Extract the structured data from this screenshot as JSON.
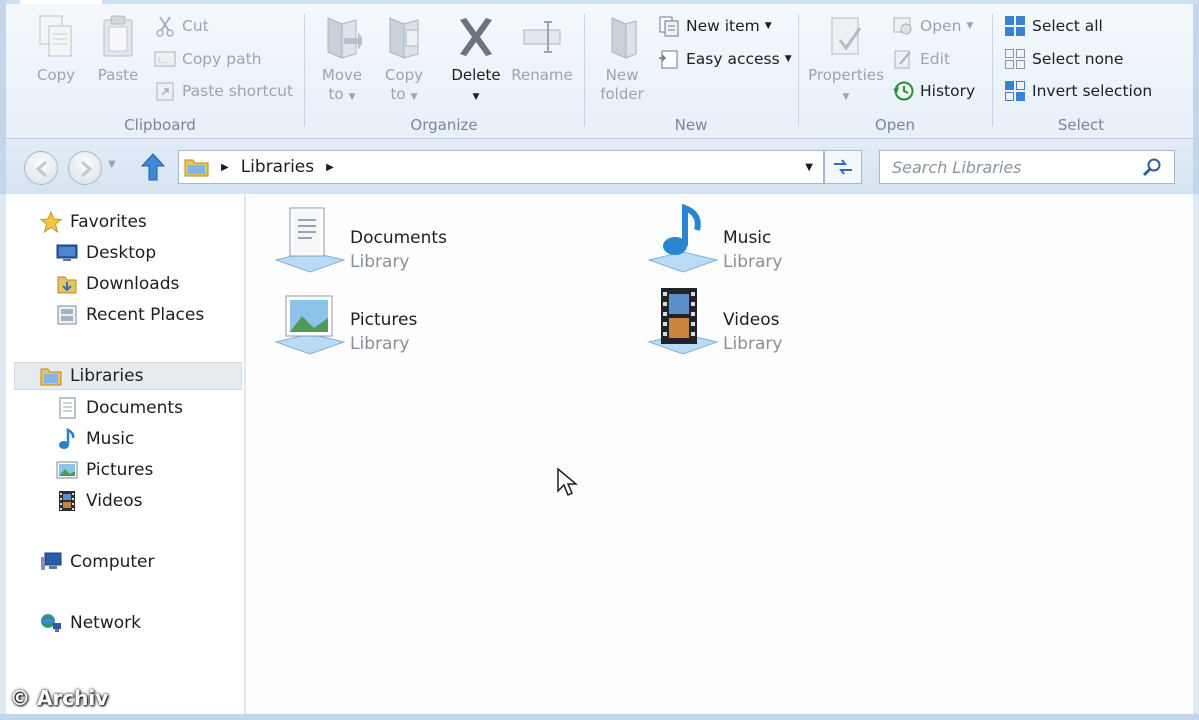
{
  "ribbon": {
    "clipboard": {
      "label": "Clipboard",
      "copy": "Copy",
      "paste": "Paste",
      "cut": "Cut",
      "copy_path": "Copy path",
      "paste_shortcut": "Paste shortcut"
    },
    "organize": {
      "label": "Organize",
      "move_to": [
        "Move",
        "to"
      ],
      "copy_to": [
        "Copy",
        "to"
      ],
      "delete": "Delete",
      "rename": "Rename"
    },
    "new": {
      "label": "New",
      "new_folder": [
        "New",
        "folder"
      ],
      "new_item": "New item",
      "easy_access": "Easy access"
    },
    "open": {
      "label": "Open",
      "properties": "Properties",
      "open": "Open",
      "edit": "Edit",
      "history": "History"
    },
    "select": {
      "label": "Select",
      "select_all": "Select all",
      "select_none": "Select none",
      "invert_selection": "Invert selection"
    }
  },
  "address": {
    "path": [
      "Libraries"
    ],
    "search_placeholder": "Search Libraries"
  },
  "nav": {
    "favorites": {
      "label": "Favorites",
      "items": [
        {
          "label": "Desktop",
          "icon": "desktop-icon"
        },
        {
          "label": "Downloads",
          "icon": "downloads-icon"
        },
        {
          "label": "Recent Places",
          "icon": "recent-places-icon"
        }
      ]
    },
    "libraries": {
      "label": "Libraries",
      "items": [
        {
          "label": "Documents",
          "icon": "documents-icon"
        },
        {
          "label": "Music",
          "icon": "music-icon"
        },
        {
          "label": "Pictures",
          "icon": "pictures-icon"
        },
        {
          "label": "Videos",
          "icon": "videos-icon"
        }
      ]
    },
    "computer": "Computer",
    "network": "Network"
  },
  "content": {
    "tiles": [
      {
        "name": "Documents",
        "type": "Library"
      },
      {
        "name": "Music",
        "type": "Library"
      },
      {
        "name": "Pictures",
        "type": "Library"
      },
      {
        "name": "Videos",
        "type": "Library"
      }
    ]
  },
  "watermark": "© Archiv",
  "colors": {
    "frame": "#c4d6ea",
    "ribbon_bg": "#eef4fa",
    "disabled_text": "#9ba5b2",
    "accent_blue": "#2f7fd0"
  }
}
